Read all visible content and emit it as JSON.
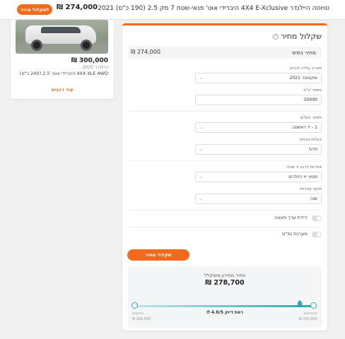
{
  "header": {
    "cta_label": "לשקלול מחיר",
    "price": "274,000 ₪",
    "title": "טויוטה היילנדר 4X4 E-Xclusive היברידי אוט' פנאי-שטח 7 מק 2.5 (190 כ\"ס) 2021"
  },
  "side_card": {
    "price": "300,000 ₪",
    "brand": "היילנדר 2020",
    "model": "4X4 XLE AWD היברידי אוט' 2.5 (240 כ\"ס)",
    "more_link": "עוד רכבים"
  },
  "calculator": {
    "title": "שקלול מחיר",
    "base_price_label": "מחיר בסיס",
    "base_price_value": "274,000 ₪",
    "fields": [
      {
        "label": "תאריך עלייה לכביש",
        "value": "אוקטובר 2021"
      },
      {
        "label": "מספר ק\"מ",
        "value": "50000"
      },
      {
        "label": "מספר בעלים",
        "value": "1 - יד ראשונה"
      },
      {
        "label": "בעלות נוכחית",
        "value": "פרטי"
      },
      {
        "label": "אחריות לרכב יד שניה",
        "value": "מטעי + היולכים"
      },
      {
        "label": "תוקף אחריות",
        "value": "שנה"
      }
    ],
    "toggles": [
      {
        "label": "ירידת ערך תאונה"
      },
      {
        "label": "מערכת גפ\"ם"
      }
    ],
    "calc_button": "שקלול מחיר",
    "result": {
      "label": "מחיר מחירון משוקלל",
      "value": "278,700 ₪",
      "min_label": "מינימום",
      "min_value": "266,600 ₪",
      "max_label": "מקסימום",
      "max_value": "290,800 ₪",
      "accuracy": "רמת דיוק 4.6/5",
      "marker_fraction": 0.92
    }
  }
}
